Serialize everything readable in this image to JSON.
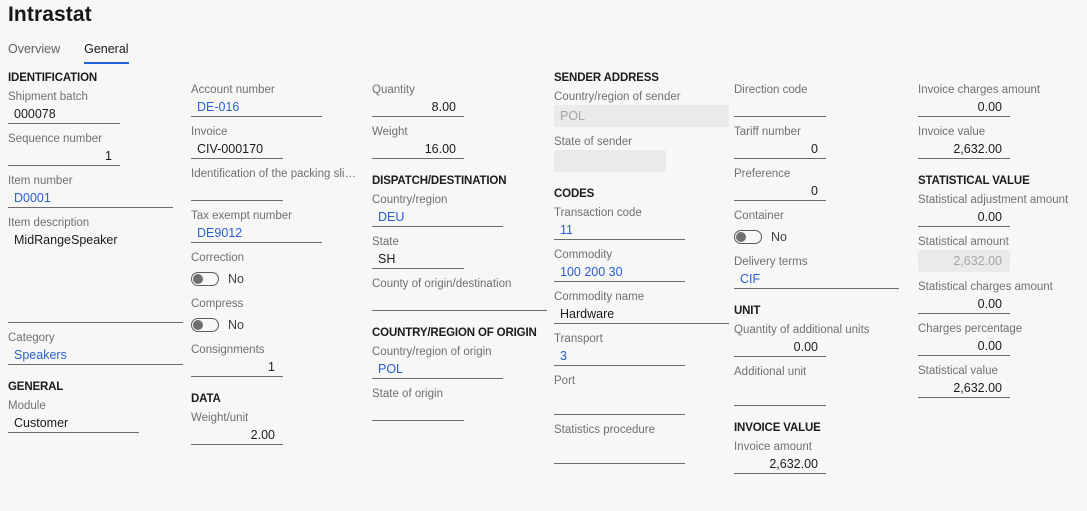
{
  "header": {
    "title": "Intrastat",
    "tabs": [
      {
        "label": "Overview",
        "active": false
      },
      {
        "label": "General",
        "active": true
      }
    ],
    "accent_color": "#2266dd"
  },
  "columns": {
    "col1": {
      "section_identification": "IDENTIFICATION",
      "shipment_batch": {
        "label": "Shipment batch",
        "value": "000078"
      },
      "sequence_number": {
        "label": "Sequence number",
        "value": "1"
      },
      "item_number": {
        "label": "Item number",
        "value": "D0001"
      },
      "item_description": {
        "label": "Item description",
        "value": "MidRangeSpeaker"
      },
      "category": {
        "label": "Category",
        "value": "Speakers"
      },
      "section_general": "GENERAL",
      "module": {
        "label": "Module",
        "value": "Customer"
      }
    },
    "col2": {
      "account_number": {
        "label": "Account number",
        "value": "DE-016"
      },
      "invoice": {
        "label": "Invoice",
        "value": "CIV-000170"
      },
      "packing_slip": {
        "label": "Identification of the packing slip...",
        "value": ""
      },
      "tax_exempt_number": {
        "label": "Tax exempt number",
        "value": "DE9012"
      },
      "correction": {
        "label": "Correction",
        "value": "No"
      },
      "compress": {
        "label": "Compress",
        "value": "No"
      },
      "consignments": {
        "label": "Consignments",
        "value": "1"
      },
      "section_data": "DATA",
      "weight_unit": {
        "label": "Weight/unit",
        "value": "2.00"
      }
    },
    "col3": {
      "quantity": {
        "label": "Quantity",
        "value": "8.00"
      },
      "weight": {
        "label": "Weight",
        "value": "16.00"
      },
      "section_dispatch": "DISPATCH/DESTINATION",
      "country_region": {
        "label": "Country/region",
        "value": "DEU"
      },
      "state": {
        "label": "State",
        "value": "SH"
      },
      "county": {
        "label": "County of origin/destination",
        "value": ""
      },
      "section_origin": "COUNTRY/REGION OF ORIGIN",
      "country_region_origin": {
        "label": "Country/region of origin",
        "value": "POL"
      },
      "state_origin": {
        "label": "State of origin",
        "value": ""
      }
    },
    "col4": {
      "section_sender": "SENDER ADDRESS",
      "country_sender": {
        "label": "Country/region of sender",
        "value": "POL"
      },
      "state_sender": {
        "label": "State of sender",
        "value": ""
      },
      "section_codes": "CODES",
      "transaction_code": {
        "label": "Transaction code",
        "value": "11"
      },
      "commodity": {
        "label": "Commodity",
        "value": "100 200 30"
      },
      "commodity_name": {
        "label": "Commodity name",
        "value": "Hardware"
      },
      "transport": {
        "label": "Transport",
        "value": "3"
      },
      "port": {
        "label": "Port",
        "value": ""
      },
      "statistics_procedure": {
        "label": "Statistics procedure",
        "value": ""
      }
    },
    "col5": {
      "direction_code": {
        "label": "Direction code",
        "value": ""
      },
      "tariff_number": {
        "label": "Tariff number",
        "value": "0"
      },
      "preference": {
        "label": "Preference",
        "value": "0"
      },
      "container": {
        "label": "Container",
        "value": "No"
      },
      "delivery_terms": {
        "label": "Delivery terms",
        "value": "CIF"
      },
      "section_unit": "UNIT",
      "quantity_additional_units": {
        "label": "Quantity of additional units",
        "value": "0.00"
      },
      "additional_unit": {
        "label": "Additional unit",
        "value": ""
      },
      "section_invoice_value": "INVOICE VALUE",
      "invoice_amount": {
        "label": "Invoice amount",
        "value": "2,632.00"
      }
    },
    "col6": {
      "invoice_charges_amount": {
        "label": "Invoice charges amount",
        "value": "0.00"
      },
      "invoice_value": {
        "label": "Invoice value",
        "value": "2,632.00"
      },
      "section_statistical_value": "STATISTICAL VALUE",
      "statistical_adjustment_amount": {
        "label": "Statistical adjustment amount",
        "value": "0.00"
      },
      "statistical_amount": {
        "label": "Statistical amount",
        "value": "2,632.00"
      },
      "statistical_charges_amount": {
        "label": "Statistical charges amount",
        "value": "0.00"
      },
      "charges_percentage": {
        "label": "Charges percentage",
        "value": "0.00"
      },
      "statistical_value": {
        "label": "Statistical value",
        "value": "2,632.00"
      }
    }
  }
}
